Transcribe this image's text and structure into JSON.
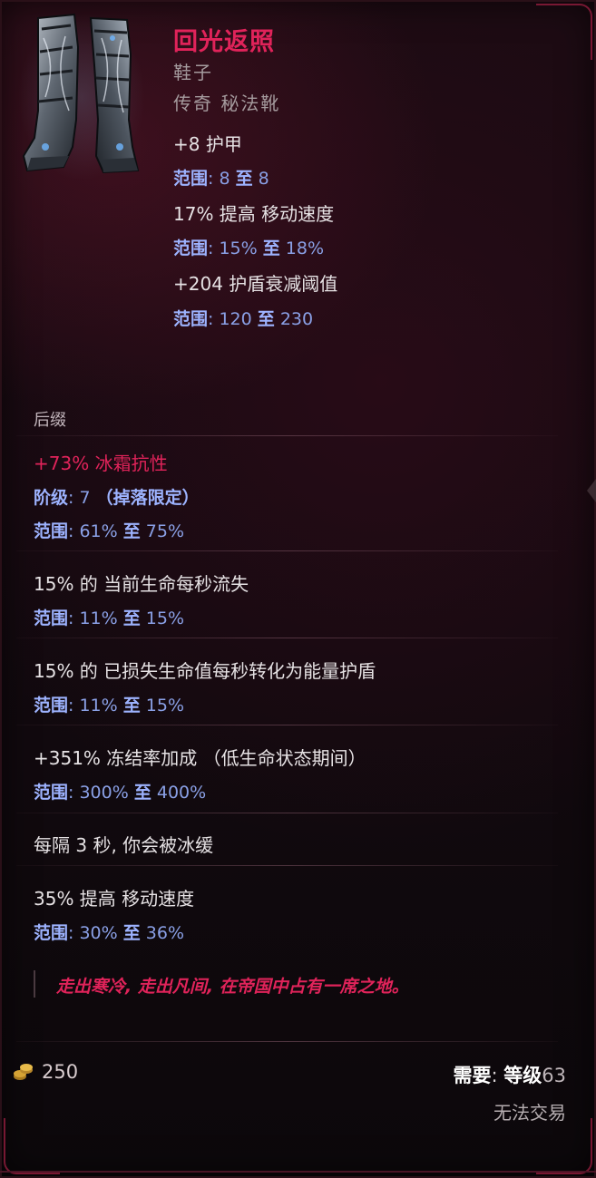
{
  "item": {
    "name": "回光返照",
    "category": "鞋子",
    "rarity_base": "传奇 秘法靴",
    "icon": "armored-boots-icon"
  },
  "base_stats": [
    {
      "text": "+8 护甲",
      "range_label": "范围",
      "range_text": ": 8 ",
      "to": "至",
      "range_end": " 8"
    },
    {
      "text": "17% 提高 移动速度",
      "range_label": "范围",
      "range_text": ": 15% ",
      "to": "至",
      "range_end": " 18%"
    },
    {
      "text": "+204 护盾衰减阈值",
      "range_label": "范围",
      "range_text": ": 120 ",
      "to": "至",
      "range_end": " 230"
    }
  ],
  "suffix_section": {
    "title": "后缀",
    "mods": [
      {
        "text": "+73% 冰霜抗性",
        "tier_label": "阶级",
        "tier_text": ": 7 ",
        "tier_note": "（掉落限定）",
        "range_label": "范围",
        "range_text": ": 61% ",
        "to": "至",
        "range_end": " 75%"
      },
      {
        "text": "15% 的 当前生命每秒流失",
        "range_label": "范围",
        "range_text": ": 11% ",
        "to": "至",
        "range_end": " 15%"
      },
      {
        "text": "15% 的 已损失生命值每秒转化为能量护盾",
        "range_label": "范围",
        "range_text": ": 11% ",
        "to": "至",
        "range_end": " 15%"
      },
      {
        "text": "+351% 冻结率加成 （低生命状态期间）",
        "range_label": "范围",
        "range_text": ": 300% ",
        "to": "至",
        "range_end": " 400%"
      },
      {
        "text": "每隔 3 秒, 你会被冰缓"
      },
      {
        "text": "35% 提高 移动速度",
        "range_label": "范围",
        "range_text": ": 30% ",
        "to": "至",
        "range_end": " 36%"
      }
    ]
  },
  "flavor_text": "走出寒冷, 走出凡间, 在帝国中占有一席之地。",
  "footer": {
    "coin_icon": "gold-coin-icon",
    "gold_value": "250",
    "requirement_prefix": "需要",
    "requirement_sep": ": ",
    "requirement_label": "等级",
    "requirement_value": "63",
    "trade_status": "无法交易"
  },
  "colors": {
    "name": "#e0235a",
    "range": "#8aa0e6",
    "stat": "#e6e2e4"
  }
}
